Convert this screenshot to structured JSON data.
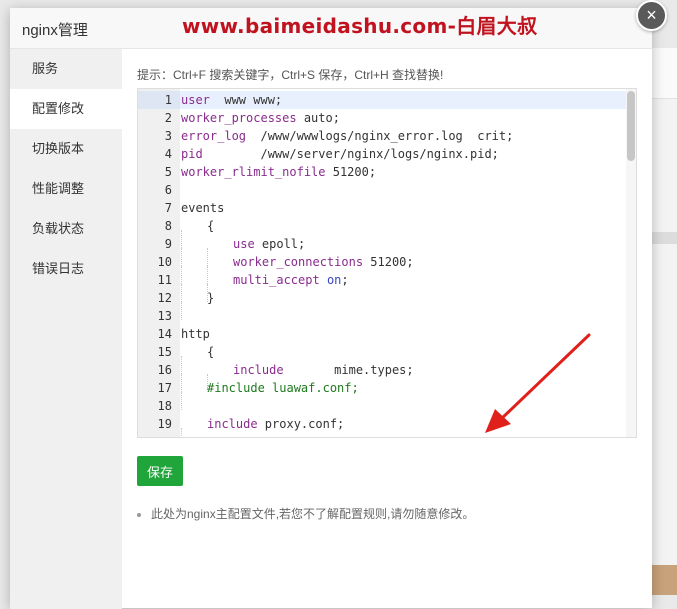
{
  "modal": {
    "title": "nginx管理",
    "watermark": "www.baimeidashu.com-白眉大叔",
    "close_glyph": "×"
  },
  "sidebar": {
    "items": [
      {
        "label": "服务"
      },
      {
        "label": "配置修改",
        "active": true
      },
      {
        "label": "切换版本"
      },
      {
        "label": "性能调整"
      },
      {
        "label": "负载状态"
      },
      {
        "label": "错误日志"
      }
    ]
  },
  "content": {
    "tip": "提示：Ctrl+F 搜索关键字，Ctrl+S 保存，Ctrl+H 查找替换!",
    "save_label": "保存",
    "note": "此处为nginx主配置文件,若您不了解配置规则,请勿随意修改。"
  },
  "editor": {
    "line_numbers": [
      "1",
      "2",
      "3",
      "4",
      "5",
      "6",
      "7",
      "8",
      "9",
      "10",
      "11",
      "12",
      "13",
      "14",
      "15",
      "16",
      "17",
      "18",
      "19"
    ],
    "lines": [
      {
        "indent": 0,
        "tokens": [
          {
            "t": "user",
            "c": "kw"
          },
          {
            "t": "  www www;",
            "c": ""
          }
        ]
      },
      {
        "indent": 0,
        "tokens": [
          {
            "t": "worker_processes",
            "c": "kw"
          },
          {
            "t": " auto;",
            "c": ""
          }
        ]
      },
      {
        "indent": 0,
        "tokens": [
          {
            "t": "error_log",
            "c": "kw"
          },
          {
            "t": "  /www/wwwlogs/nginx_error.log  crit;",
            "c": ""
          }
        ]
      },
      {
        "indent": 0,
        "tokens": [
          {
            "t": "pid",
            "c": "kw"
          },
          {
            "t": "        /www/server/nginx/logs/nginx.pid;",
            "c": ""
          }
        ]
      },
      {
        "indent": 0,
        "tokens": [
          {
            "t": "worker_rlimit_nofile",
            "c": "kw"
          },
          {
            "t": " 51200;",
            "c": ""
          }
        ]
      },
      {
        "indent": 0,
        "tokens": []
      },
      {
        "indent": 0,
        "tokens": [
          {
            "t": "events",
            "c": ""
          }
        ]
      },
      {
        "indent": 1,
        "tokens": [
          {
            "t": "{",
            "c": ""
          }
        ]
      },
      {
        "indent": 2,
        "tokens": [
          {
            "t": "use",
            "c": "kw"
          },
          {
            "t": " epoll;",
            "c": ""
          }
        ]
      },
      {
        "indent": 2,
        "tokens": [
          {
            "t": "worker_connections",
            "c": "kw"
          },
          {
            "t": " 51200;",
            "c": ""
          }
        ]
      },
      {
        "indent": 2,
        "tokens": [
          {
            "t": "multi_accept",
            "c": "kw"
          },
          {
            "t": " ",
            "c": ""
          },
          {
            "t": "on",
            "c": "kwb"
          },
          {
            "t": ";",
            "c": ""
          }
        ]
      },
      {
        "indent": 1,
        "tokens": [
          {
            "t": "}",
            "c": ""
          }
        ]
      },
      {
        "indent": 0,
        "tokens": []
      },
      {
        "indent": 0,
        "tokens": [
          {
            "t": "http",
            "c": ""
          }
        ]
      },
      {
        "indent": 1,
        "tokens": [
          {
            "t": "{",
            "c": ""
          }
        ]
      },
      {
        "indent": 2,
        "tokens": [
          {
            "t": "include",
            "c": "kw"
          },
          {
            "t": "       mime.types;",
            "c": ""
          }
        ]
      },
      {
        "indent": 1,
        "tokens": [
          {
            "t": "#include luawaf.conf;",
            "c": "cm"
          }
        ]
      },
      {
        "indent": 0,
        "tokens": []
      },
      {
        "indent": 1,
        "tokens": [
          {
            "t": "include",
            "c": "kw"
          },
          {
            "t": " proxy.conf;",
            "c": ""
          }
        ]
      }
    ]
  },
  "colors": {
    "accent_green": "#20a53a",
    "watermark_red": "#c1121f",
    "arrow_red": "#e0211b",
    "keyword": "#8a2c8f",
    "comment": "#1e7a1e"
  },
  "icons": {
    "close": "close-icon",
    "annotation": "red-arrow-annotation"
  }
}
